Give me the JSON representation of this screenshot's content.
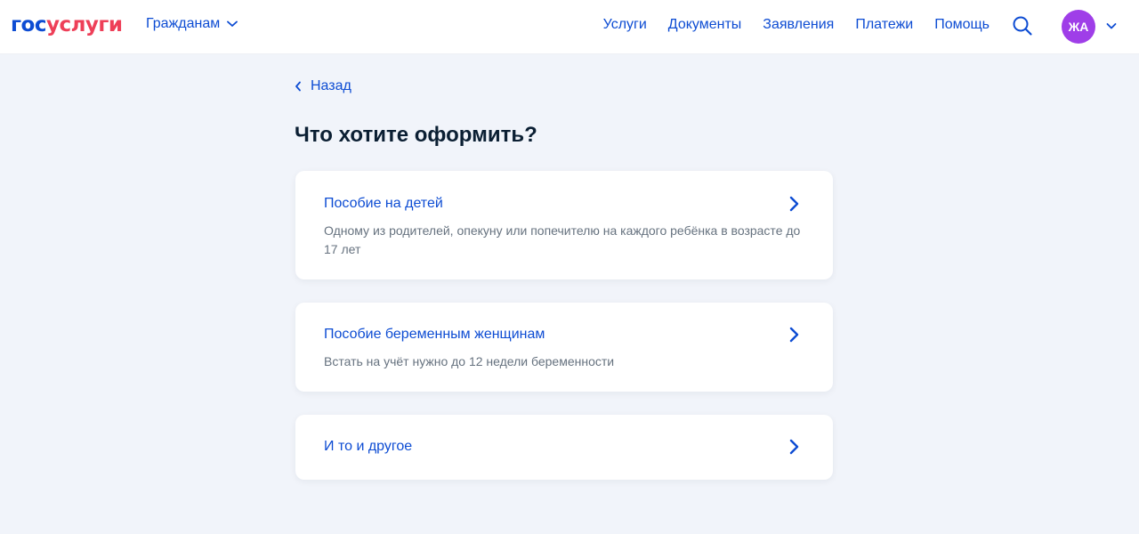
{
  "header": {
    "logo_part1": "гос",
    "logo_part2": "услуги",
    "audience_label": "Гражданам",
    "nav": [
      "Услуги",
      "Документы",
      "Заявления",
      "Платежи",
      "Помощь"
    ],
    "avatar_initials": "ЖА"
  },
  "page": {
    "back_label": "Назад",
    "title": "Что хотите оформить?"
  },
  "options": [
    {
      "title": "Пособие на детей",
      "description": "Одному из родителей, опекуну или попечителю на каждого ребёнка в возрасте до 17 лет"
    },
    {
      "title": "Пособие беременным женщинам",
      "description": "Встать на учёт нужно до 12 недели беременности"
    },
    {
      "title": "И то и другое",
      "description": ""
    }
  ],
  "colors": {
    "accent": "#0d4cd3",
    "brand_red": "#ee3f58",
    "avatar": "#9f3ee8",
    "background": "#f1f4fa"
  },
  "icons": [
    "chevron-down-icon",
    "search-icon",
    "chevron-left-icon",
    "chevron-right-icon"
  ]
}
